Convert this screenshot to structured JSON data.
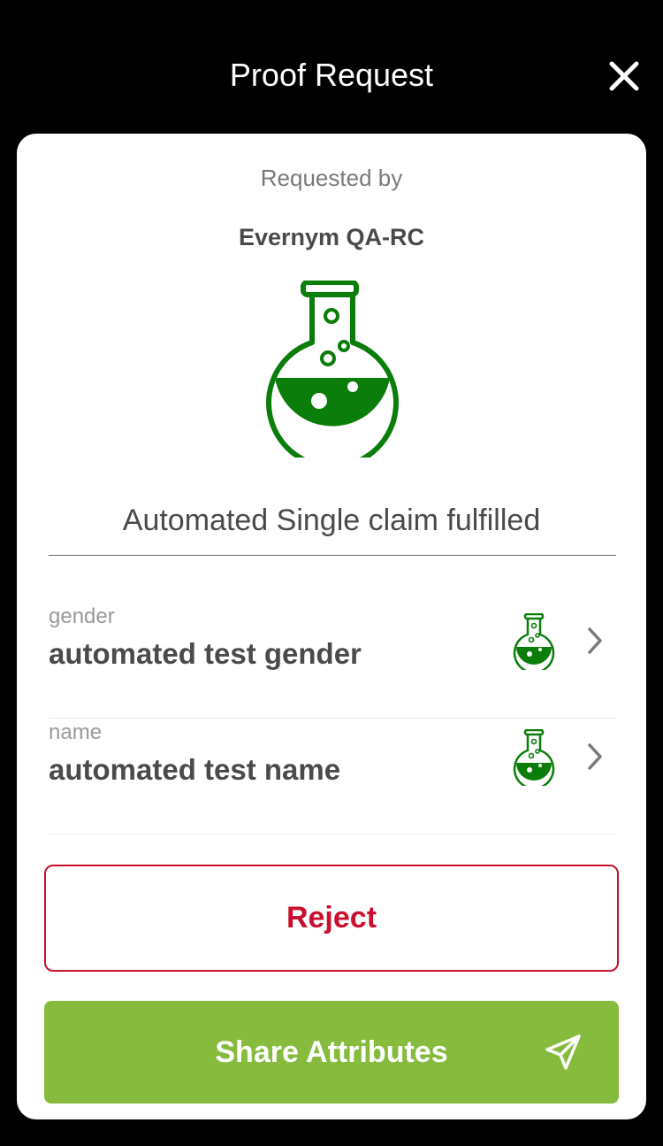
{
  "header": {
    "title": "Proof Request",
    "close_icon": "close-icon"
  },
  "request": {
    "requested_by_label": "Requested by",
    "requester_name": "Evernym QA-RC",
    "logo_icon": "flask-icon",
    "proof_name": "Automated Single claim fulfilled"
  },
  "attributes": [
    {
      "label": "gender",
      "value": "automated test gender",
      "icon": "flask-icon"
    },
    {
      "label": "name",
      "value": "automated test name",
      "icon": "flask-icon"
    }
  ],
  "actions": {
    "reject_label": "Reject",
    "share_label": "Share Attributes",
    "share_icon": "send-icon"
  },
  "colors": {
    "background": "#000000",
    "card": "#ffffff",
    "flask_green": "#0a7d0a",
    "reject_red": "#c8102e",
    "share_green": "#86bb3d"
  }
}
